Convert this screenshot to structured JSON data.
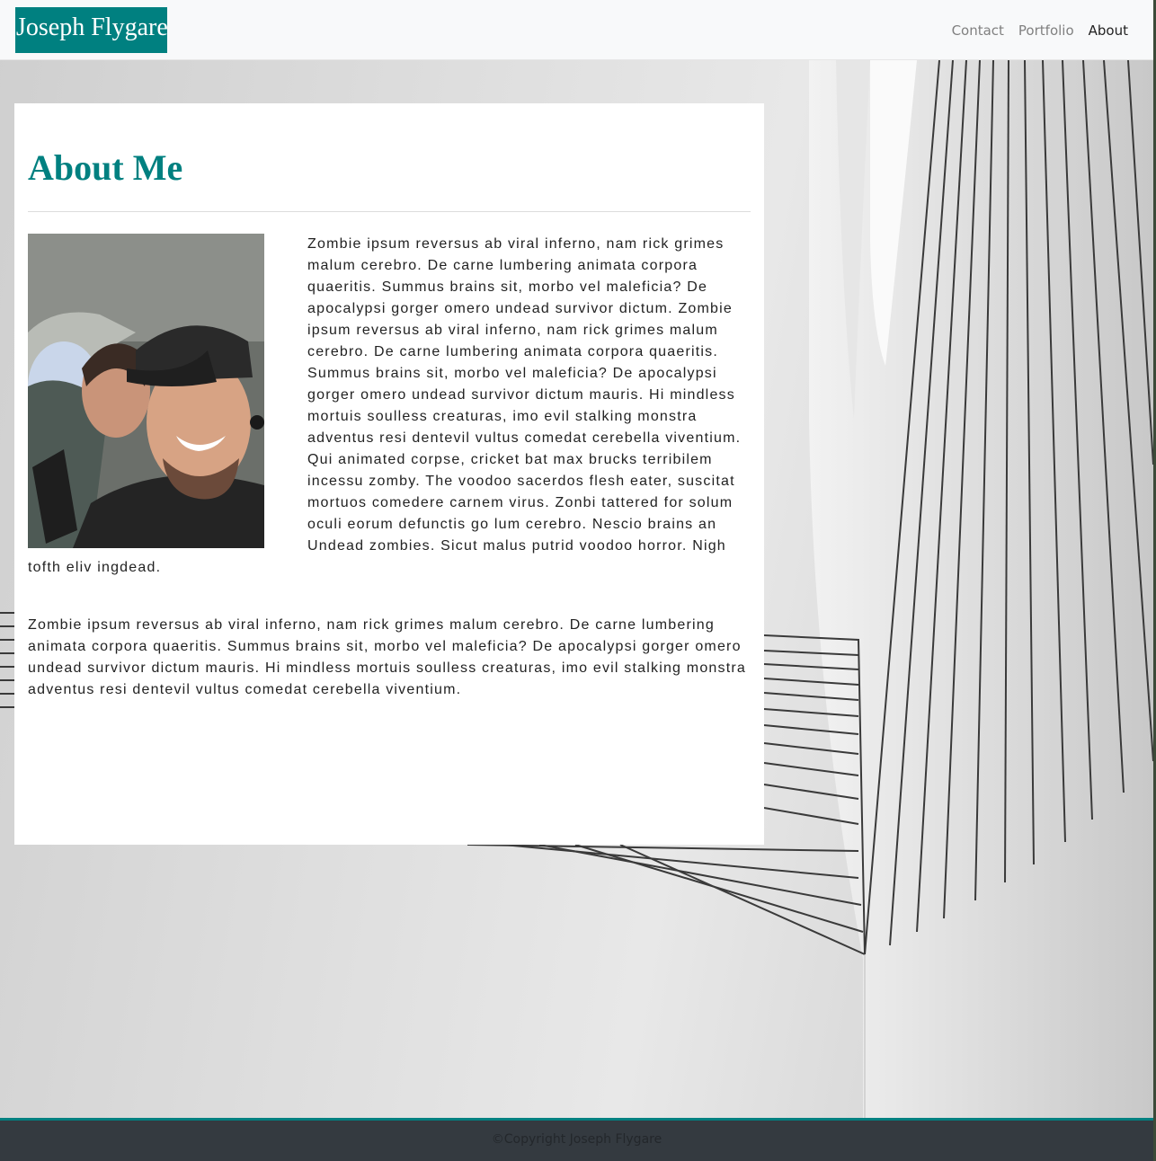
{
  "navbar": {
    "brand": "Joseph Flygare",
    "links": [
      {
        "label": "Contact",
        "active": false
      },
      {
        "label": "Portfolio",
        "active": false
      },
      {
        "label": "About",
        "active": true
      }
    ]
  },
  "main": {
    "heading": "About Me",
    "paragraph_1": "Zombie ipsum reversus ab viral inferno, nam rick grimes malum cerebro. De carne lumbering animata corpora quaeritis. Summus brains sit, morbo vel maleficia? De apocalypsi gorger omero undead survivor dictum. Zombie ipsum reversus ab viral inferno, nam rick grimes malum cerebro. De carne lumbering animata corpora quaeritis. Summus brains sit, morbo vel maleficia? De apocalypsi gorger omero undead survivor dictum mauris. Hi mindless mortuis soulless creaturas, imo evil stalking monstra adventus resi dentevil vultus comedat cerebella viventium. Qui animated corpse, cricket bat max brucks terribilem incessu zomby. The voodoo sacerdos flesh eater, suscitat mortuos comedere carnem virus. Zonbi tattered for solum oculi eorum defunctis go lum cerebro. Nescio brains an Undead zombies. Sicut malus putrid voodoo horror. Nigh tofth eliv ingdead.",
    "paragraph_2": "Zombie ipsum reversus ab viral inferno, nam rick grimes malum cerebro. De carne lumbering animata corpora quaeritis. Summus brains sit, morbo vel maleficia? De apocalypsi gorger omero undead survivor dictum mauris. Hi mindless mortuis soulless creaturas, imo evil stalking monstra adventus resi dentevil vultus comedat cerebella viventium."
  },
  "footer": {
    "copyright": "©Copyright Joseph Flygare"
  },
  "colors": {
    "accent": "#008080",
    "navbar_bg": "#f8f9fa",
    "footer_bg": "#343a40"
  }
}
